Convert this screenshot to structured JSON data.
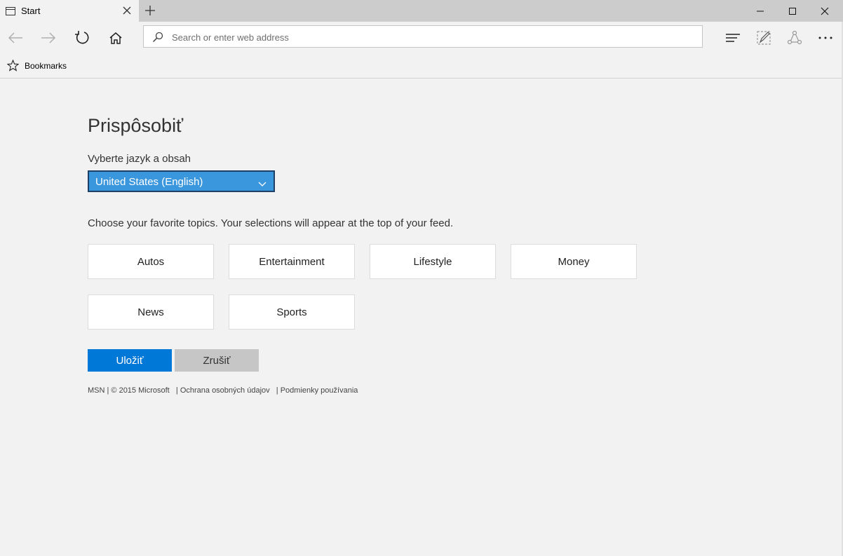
{
  "tab": {
    "title": "Start"
  },
  "address": {
    "placeholder": "Search or enter web address"
  },
  "bookmarks": {
    "label": "Bookmarks"
  },
  "main": {
    "title": "Prispôsobiť",
    "language_label": "Vyberte jazyk a obsah",
    "language_selected": "United States (English)",
    "topics_label": "Choose your favorite topics. Your selections will appear at the top of your feed.",
    "topics": [
      "Autos",
      "Entertainment",
      "Lifestyle",
      "Money",
      "News",
      "Sports"
    ],
    "save_label": "Uložiť",
    "cancel_label": "Zrušiť"
  },
  "footer": {
    "copyright": "MSN | © 2015 Microsoft",
    "privacy": "| Ochrana osobných údajov",
    "terms": "| Podmienky používania"
  },
  "icons": {
    "back": "back-arrow-icon",
    "forward": "forward-arrow-icon",
    "refresh": "refresh-icon",
    "home": "home-icon",
    "hub": "hub-icon",
    "note": "web-note-icon",
    "share": "share-icon",
    "more": "more-icon"
  },
  "colors": {
    "accent": "#0078d7",
    "select_bg": "#3a96dd",
    "cancel_bg": "#c6c6c6",
    "page_bg": "#f2f2f2"
  }
}
